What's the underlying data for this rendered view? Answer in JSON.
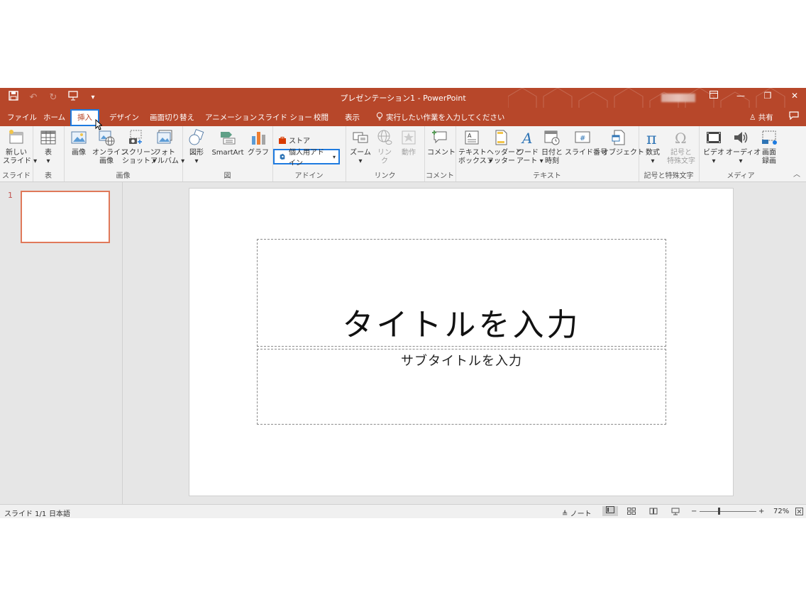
{
  "window": {
    "title": "プレゼンテーション1 - PowerPoint",
    "qat": {
      "save_icon": "save-icon",
      "undo_icon": "undo-icon",
      "redo_icon": "redo-icon",
      "present_icon": "start-from-beginning-icon",
      "customize": "▾"
    }
  },
  "tabs": [
    "ファイル",
    "ホーム",
    "挿入",
    "デザイン",
    "画面切り替え",
    "アニメーション",
    "スライド ショー",
    "校閲",
    "表示"
  ],
  "active_tab": "挿入",
  "tell_me": "実行したい作業を入力してください",
  "share": "共有",
  "ribbon": {
    "slides": {
      "label": "スライド",
      "new_slide": [
        "新しい",
        "スライド ▾"
      ]
    },
    "tables": {
      "label": "表",
      "table": "表"
    },
    "images": {
      "label": "画像",
      "picture": "画像",
      "online_pictures": [
        "オンライン",
        "画像"
      ],
      "screenshot": [
        "スクリーン",
        "ショット ▾"
      ],
      "photo_album": [
        "フォト",
        "アルバム ▾"
      ]
    },
    "illustrations": {
      "label": "図",
      "shapes": "図形",
      "smartart": "SmartArt",
      "chart": "グラフ"
    },
    "addins": {
      "label": "アドイン",
      "store": "ストア",
      "my_addins": "個人用アドイン"
    },
    "links": {
      "label": "リンク",
      "zoom": "ズーム",
      "link": [
        "リン",
        "ク"
      ],
      "action": "動作"
    },
    "comments": {
      "label": "コメント",
      "comment": "コメント"
    },
    "text": {
      "label": "テキスト",
      "textbox": [
        "テキスト",
        "ボックス ▾"
      ],
      "header_footer": [
        "ヘッダーと",
        "フッター"
      ],
      "wordart": [
        "ワード",
        "アート ▾"
      ],
      "datetime": [
        "日付と",
        "時刻"
      ],
      "slide_number": "スライド番号",
      "object": "オブジェクト"
    },
    "symbols": {
      "label": "記号と特殊文字",
      "equation": "数式",
      "symbol": [
        "記号と",
        "特殊文字"
      ]
    },
    "media": {
      "label": "メディア",
      "video": "ビデオ",
      "audio": "オーディオ",
      "screen_recording": [
        "画面",
        "録画"
      ]
    }
  },
  "thumbnails": {
    "number": "1"
  },
  "slide": {
    "title_placeholder": "タイトルを入力",
    "subtitle_placeholder": "サブタイトルを入力"
  },
  "status": {
    "slide_info": "スライド 1/1",
    "language": "日本語",
    "notes": "ノート",
    "zoom": "72%"
  },
  "colors": {
    "accent": "#b7472a",
    "highlight": "#1e7be0",
    "thumb_border": "#e0795a"
  }
}
